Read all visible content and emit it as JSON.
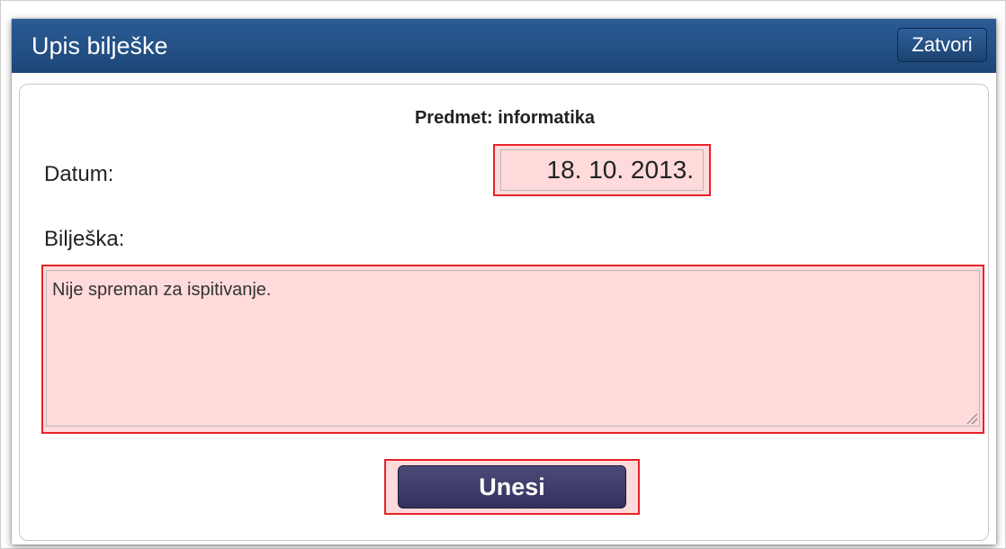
{
  "dialog": {
    "title": "Upis bilješke",
    "close_label": "Zatvori"
  },
  "form": {
    "subject": "Predmet: informatika",
    "date_label": "Datum:",
    "date_value": "18. 10. 2013.",
    "note_label": "Bilješka:",
    "note_value": "Nije spreman za ispitivanje.",
    "submit_label": "Unesi"
  },
  "colors": {
    "titlebar": "#1d4678",
    "highlight_border": "#e8232a",
    "highlight_fill": "#ffdada",
    "submit_button": "#3b3966"
  }
}
